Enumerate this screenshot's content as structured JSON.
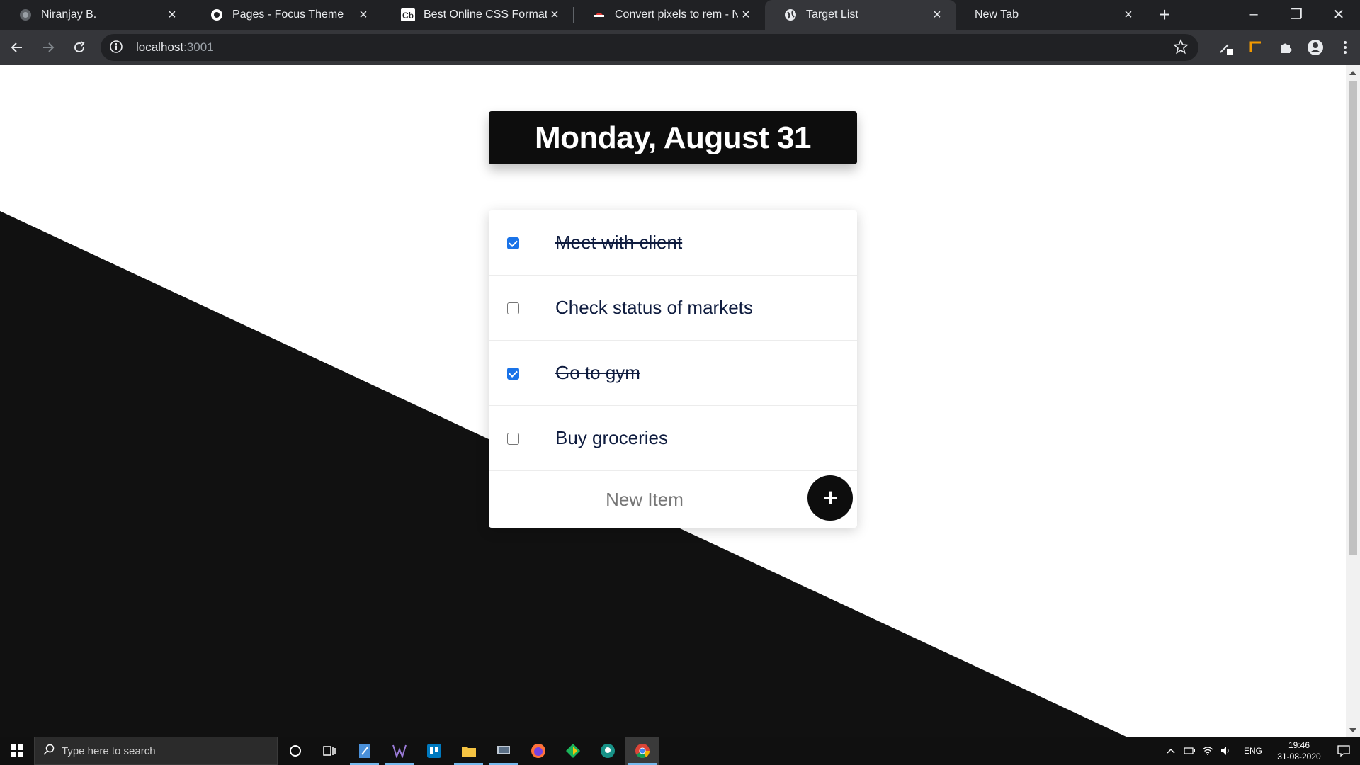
{
  "browser": {
    "tabs": [
      {
        "title": "Niranjay B.",
        "favicon": "globe-icon",
        "active": false
      },
      {
        "title": "Pages - Focus Theme",
        "favicon": "circle-logo-icon",
        "active": false
      },
      {
        "title": "Best Online CSS Formatter",
        "favicon": "cb-logo-icon",
        "active": false
      },
      {
        "title": "Convert pixels to rem - Niran",
        "favicon": "ninja-icon",
        "active": false
      },
      {
        "title": "Target List",
        "favicon": "globe-icon",
        "active": true
      },
      {
        "title": "New Tab",
        "favicon": "none",
        "active": false
      }
    ],
    "address": {
      "host": "localhost",
      "port": ":3001"
    }
  },
  "app": {
    "date_heading": "Monday, August 31",
    "todos": [
      {
        "label": "Meet with client",
        "done": true
      },
      {
        "label": "Check status of markets",
        "done": false
      },
      {
        "label": "Go to gym",
        "done": true
      },
      {
        "label": "Buy groceries",
        "done": false
      }
    ],
    "new_item": {
      "placeholder": "New Item",
      "add_label": "+"
    },
    "colors": {
      "checkbox_checked": "#1a73e8",
      "header_bg": "#0d0d0d",
      "diagonal_bg": "#111111",
      "item_text": "#0f1c3f"
    }
  },
  "taskbar": {
    "search_placeholder": "Type here to search",
    "language": "ENG",
    "time": "19:46",
    "date": "31-08-2020"
  }
}
